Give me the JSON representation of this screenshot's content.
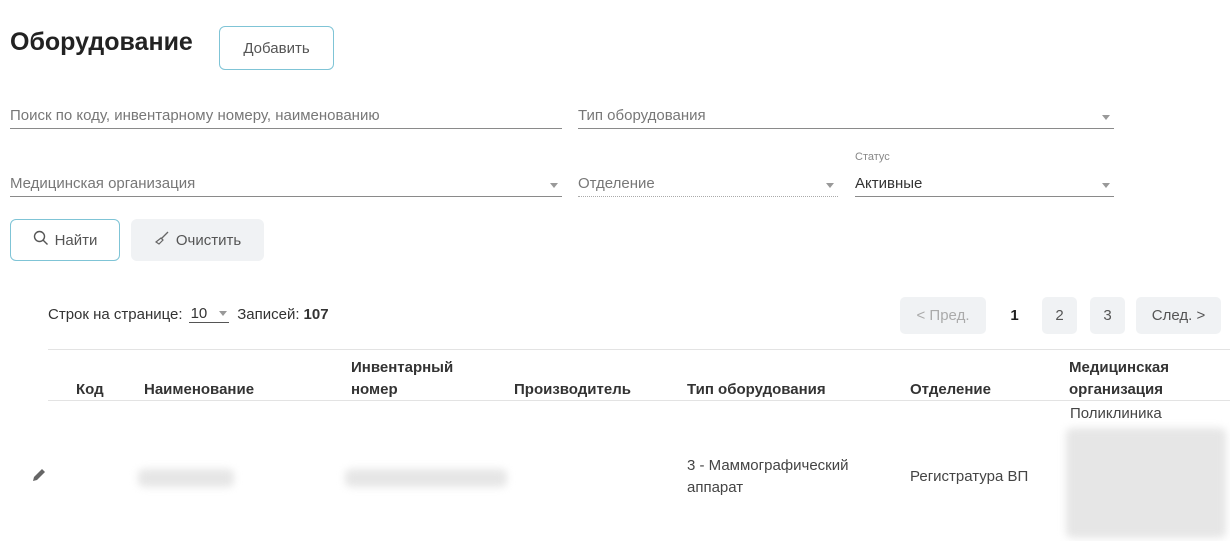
{
  "header": {
    "title": "Оборудование",
    "add_label": "Добавить"
  },
  "filters": {
    "search_placeholder": "Поиск по коду, инвентарному номеру, наименованию",
    "equipment_type_placeholder": "Тип оборудования",
    "med_org_placeholder": "Медицинская организация",
    "department_placeholder": "Отделение",
    "status_label": "Статус",
    "status_value": "Активные"
  },
  "actions": {
    "find_label": "Найти",
    "clear_label": "Очистить"
  },
  "pagination": {
    "rows_label": "Строк на странице:",
    "rows_value": "10",
    "records_label": "Записей:",
    "records_count": "107",
    "prev_label": "< Пред.",
    "pages": [
      "1",
      "2",
      "3"
    ],
    "next_label": "След. >"
  },
  "table": {
    "columns": {
      "code": "Код",
      "name": "Наименование",
      "inventory_line1": "Инвентарный",
      "inventory_line2": "номер",
      "manufacturer": "Производитель",
      "equipment_type": "Тип оборудования",
      "department": "Отделение",
      "med_org_line1": "Медицинская",
      "med_org_line2": "организация"
    },
    "rows": [
      {
        "equipment_type_line1": "3 - Маммографический",
        "equipment_type_line2": "аппарат",
        "department": "Регистратура ВП",
        "med_org": "Поликлиника"
      }
    ]
  }
}
